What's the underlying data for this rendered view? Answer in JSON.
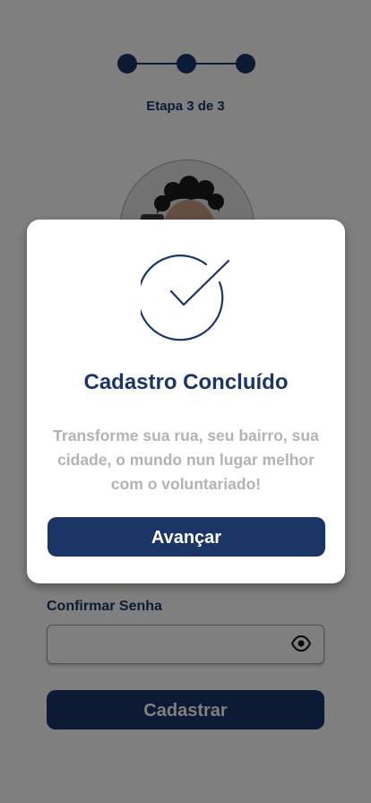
{
  "stepper": {
    "label": "Etapa 3 de 3",
    "steps_total": 3,
    "current_step": 3
  },
  "form": {
    "confirm_password_label": "Confirmar Senha",
    "confirm_password_value": "",
    "register_label": "Cadastrar"
  },
  "modal": {
    "icon": "check-circle-icon",
    "title": "Cadastro Concluído",
    "message": "Transforme sua rua, seu bairro, sua cidade, o mundo nun lugar melhor com o voluntariado!",
    "advance_label": "Avançar"
  },
  "icons": {
    "eye": "eye-icon"
  },
  "colors": {
    "primary": "#1b3566",
    "muted_text": "#b3b3b3",
    "overlay": "rgba(0,0,0,0.5)"
  }
}
